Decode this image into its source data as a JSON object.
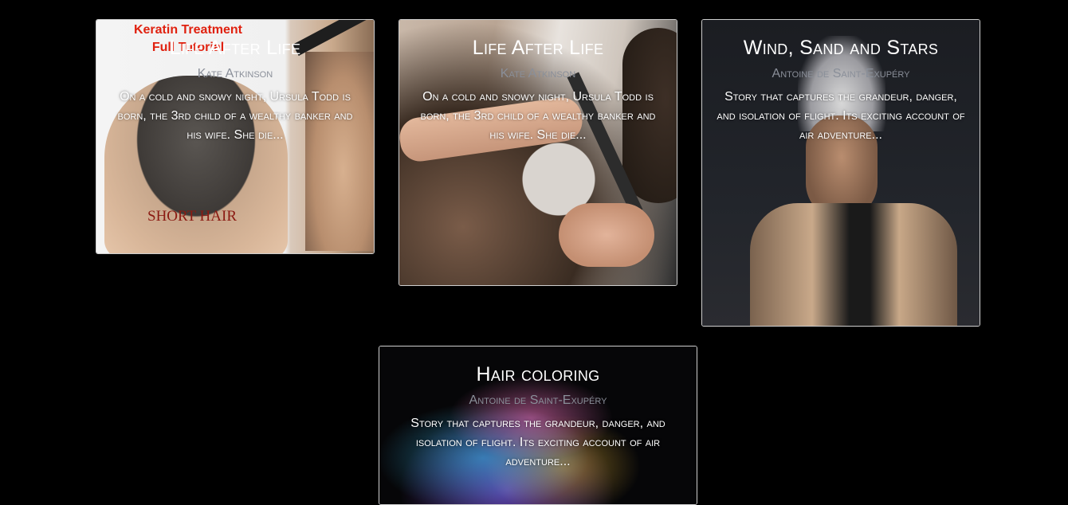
{
  "cards": [
    {
      "title": "Life After Life",
      "author": "Kate Atkinson",
      "description": "On a cold and snowy night, Ursula Todd is born, the 3rd child of a wealthy banker and his wife. She die...",
      "image": {
        "ad_title_line1": "Keratin Treatment",
        "ad_title_line2": "Full Tutorial",
        "ad_caption": "SHORT HAIR"
      }
    },
    {
      "title": "Life After Life",
      "author": "Kate Atkinson",
      "description": "On a cold and snowy night, Ursula Todd is born, the 3rd child of a wealthy banker and his wife. She die..."
    },
    {
      "title": "Wind, Sand and Stars",
      "author": "Antoine de Saint-Exupéry",
      "description": "Story that captures the grandeur, danger, and isolation of flight. Its exciting account of air adventure..."
    },
    {
      "title": "Hair coloring",
      "author": "Antoine de Saint-Exupéry",
      "description": "Story that captures the grandeur, danger, and isolation of flight. Its exciting account of air adventure..."
    }
  ],
  "colors": {
    "page_background": "#000000",
    "card_border": "#cfcfcf",
    "title_text": "#ffffff",
    "author_text": "#8a8f99",
    "ad_red": "#e0210f"
  }
}
